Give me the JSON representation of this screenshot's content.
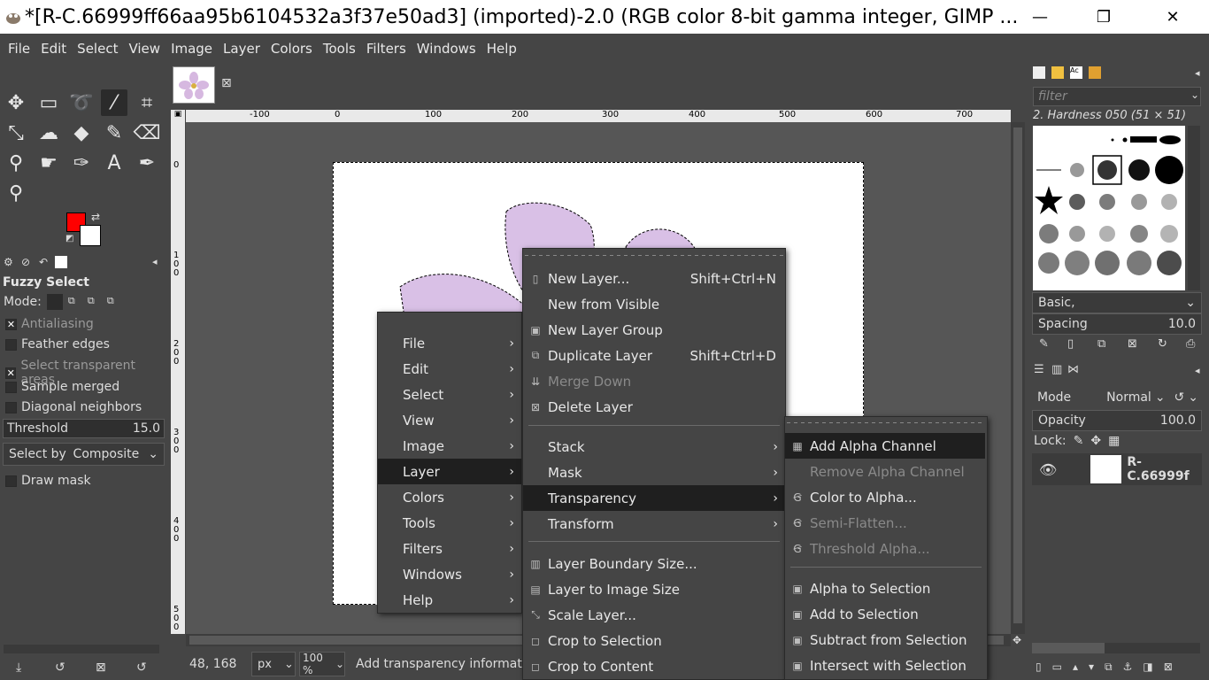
{
  "window": {
    "title": "*[R-C.66999ff66aa95b6104532a3f37e50ad3] (imported)-2.0 (RGB color 8-bit gamma integer, GIMP ...",
    "minimize": "—",
    "maximize": "❐",
    "close": "✕"
  },
  "menubar": [
    "File",
    "Edit",
    "Select",
    "View",
    "Image",
    "Layer",
    "Colors",
    "Tools",
    "Filters",
    "Windows",
    "Help"
  ],
  "tool_options": {
    "title": "Fuzzy Select",
    "mode_label": "Mode:",
    "antialiasing": "Antialiasing",
    "feather": "Feather edges",
    "select_transparent": "Select transparent areas",
    "sample_merged": "Sample merged",
    "diagonal": "Diagonal neighbors",
    "threshold_label": "Threshold",
    "threshold_value": "15.0",
    "select_by_label": "Select by",
    "select_by_value": "Composite",
    "draw_mask": "Draw mask"
  },
  "ruler_top_labels": [
    "-100",
    "0",
    "100",
    "200",
    "300",
    "400",
    "500",
    "600",
    "700"
  ],
  "ruler_left_labels": [
    "0",
    "1\n0\n0",
    "2\n0\n0",
    "3\n0\n0",
    "4\n0\n0",
    "5\n0\n0"
  ],
  "status": {
    "coords": "48, 168",
    "unit": "px",
    "zoom": "100 %",
    "message": "Add transparency information"
  },
  "brushes": {
    "filter_placeholder": "filter",
    "current": "2. Hardness 050 (51 × 51)",
    "preset": "Basic,",
    "spacing_label": "Spacing",
    "spacing_value": "10.0"
  },
  "layers": {
    "mode_label": "Mode",
    "mode_value": "Normal",
    "opacity_label": "Opacity",
    "opacity_value": "100.0",
    "lock_label": "Lock:",
    "layer_name": "R-C.66999f"
  },
  "context_menu": {
    "items": [
      {
        "label": "File"
      },
      {
        "label": "Edit"
      },
      {
        "label": "Select"
      },
      {
        "label": "View"
      },
      {
        "label": "Image"
      },
      {
        "label": "Layer"
      },
      {
        "label": "Colors"
      },
      {
        "label": "Tools"
      },
      {
        "label": "Filters"
      },
      {
        "label": "Windows"
      },
      {
        "label": "Help"
      }
    ]
  },
  "layer_menu": {
    "new_layer": "New Layer...",
    "new_layer_sc": "Shift+Ctrl+N",
    "new_from_visible": "New from Visible",
    "new_layer_group": "New Layer Group",
    "duplicate_layer": "Duplicate Layer",
    "duplicate_sc": "Shift+Ctrl+D",
    "merge_down": "Merge Down",
    "delete_layer": "Delete Layer",
    "stack": "Stack",
    "mask": "Mask",
    "transparency": "Transparency",
    "transform": "Transform",
    "boundary": "Layer Boundary Size...",
    "to_image_size": "Layer to Image Size",
    "scale": "Scale Layer...",
    "crop_sel": "Crop to Selection",
    "crop_content": "Crop to Content"
  },
  "transparency_menu": {
    "add_alpha": "Add Alpha Channel",
    "remove_alpha": "Remove Alpha Channel",
    "color_to_alpha": "Color to Alpha...",
    "semi_flatten": "Semi-Flatten...",
    "threshold_alpha": "Threshold Alpha...",
    "alpha_to_sel": "Alpha to Selection",
    "add_to_sel": "Add to Selection",
    "subtract_sel": "Subtract from Selection",
    "intersect_sel": "Intersect with Selection"
  },
  "colors": {
    "fg": "#ff0000",
    "bg": "#ffffff",
    "menu_highlight": "#1f1f1f",
    "flower": "#c9a6d6"
  }
}
